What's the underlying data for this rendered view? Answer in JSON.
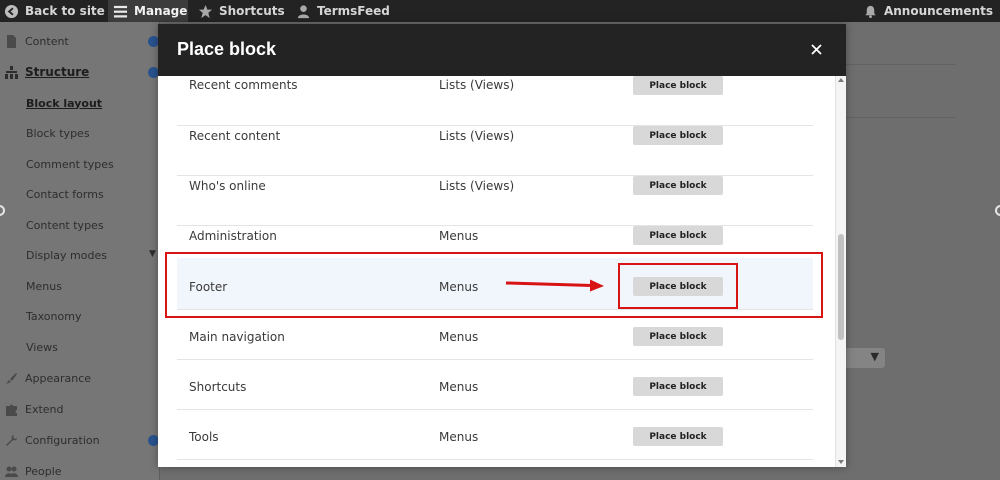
{
  "toolbar": {
    "back_label": "Back to site",
    "manage_label": "Manage",
    "shortcuts_label": "Shortcuts",
    "user_label": "TermsFeed",
    "announcements_label": "Announcements"
  },
  "sidebar": {
    "content": "Content",
    "structure": "Structure",
    "block_layout": "Block layout",
    "block_types": "Block types",
    "comment_types": "Comment types",
    "contact_forms": "Contact forms",
    "content_types": "Content types",
    "display_modes": "Display modes",
    "menus": "Menus",
    "taxonomy": "Taxonomy",
    "views": "Views",
    "appearance": "Appearance",
    "extend": "Extend",
    "configuration": "Configuration",
    "people": "People"
  },
  "modal": {
    "title": "Place block",
    "close_icon": "close-icon",
    "rows": [
      {
        "name": "Recent comments",
        "category": "Lists (Views)",
        "button": "Place block"
      },
      {
        "name": "Recent content",
        "category": "Lists (Views)",
        "button": "Place block"
      },
      {
        "name": "Who's online",
        "category": "Lists (Views)",
        "button": "Place block"
      },
      {
        "name": "Administration",
        "category": "Menus",
        "button": "Place block"
      },
      {
        "name": "Footer",
        "category": "Menus",
        "button": "Place block"
      },
      {
        "name": "Main navigation",
        "category": "Menus",
        "button": "Place block"
      },
      {
        "name": "Shortcuts",
        "category": "Menus",
        "button": "Place block"
      },
      {
        "name": "Tools",
        "category": "Menus",
        "button": "Place block"
      }
    ]
  },
  "colors": {
    "header_bg": "#232323",
    "annotation": "#d81313",
    "highlight_row": "#f1f5fc",
    "button_bg": "#d8d8d8"
  }
}
